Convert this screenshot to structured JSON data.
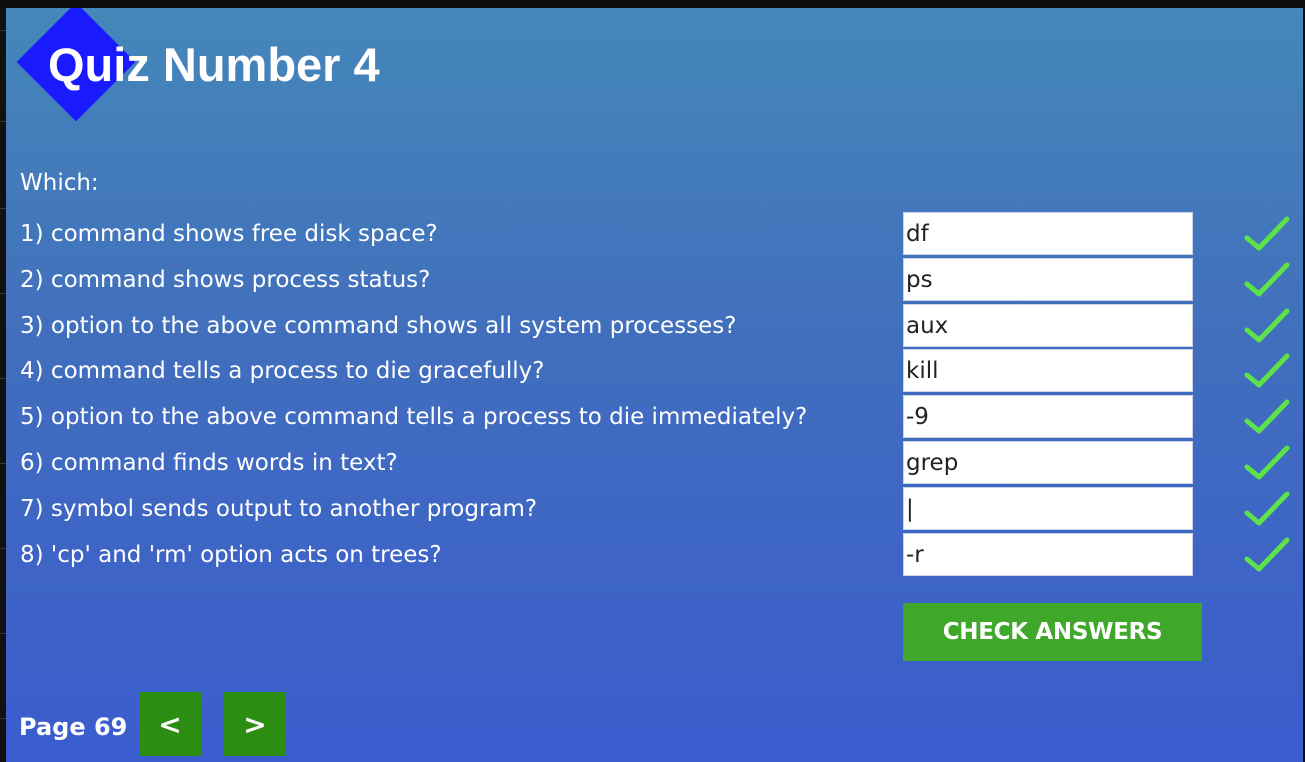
{
  "quiz": {
    "title": "Quiz Number 4",
    "prompt": "Which:",
    "questions": [
      {
        "text": "1) command shows free disk space?",
        "answer": "df",
        "correct": true
      },
      {
        "text": "2) command shows process status?",
        "answer": "ps",
        "correct": true
      },
      {
        "text": "3) option to the above command shows all system processes?",
        "answer": "aux",
        "correct": true
      },
      {
        "text": "4) command tells a process to die gracefully?",
        "answer": "kill",
        "correct": true
      },
      {
        "text": "5) option to the above command tells a process to die immediately?",
        "answer": "-9",
        "correct": true
      },
      {
        "text": "6) command finds words in text?",
        "answer": "grep",
        "correct": true
      },
      {
        "text": "7) symbol sends output to another program?",
        "answer": "|",
        "correct": true
      },
      {
        "text": "8) 'cp' and 'rm' option acts on trees?",
        "answer": "-r",
        "correct": true
      }
    ],
    "check_label": "CHECK ANSWERS",
    "correct_icon": "checkmark-icon",
    "correct_color": "#5de24a"
  },
  "nav": {
    "page_label": "Page 69",
    "prev_label": "<",
    "next_label": ">"
  },
  "colors": {
    "diamond": "#1a1aff",
    "button_green": "#3fa82b",
    "nav_green": "#2b8d12"
  }
}
